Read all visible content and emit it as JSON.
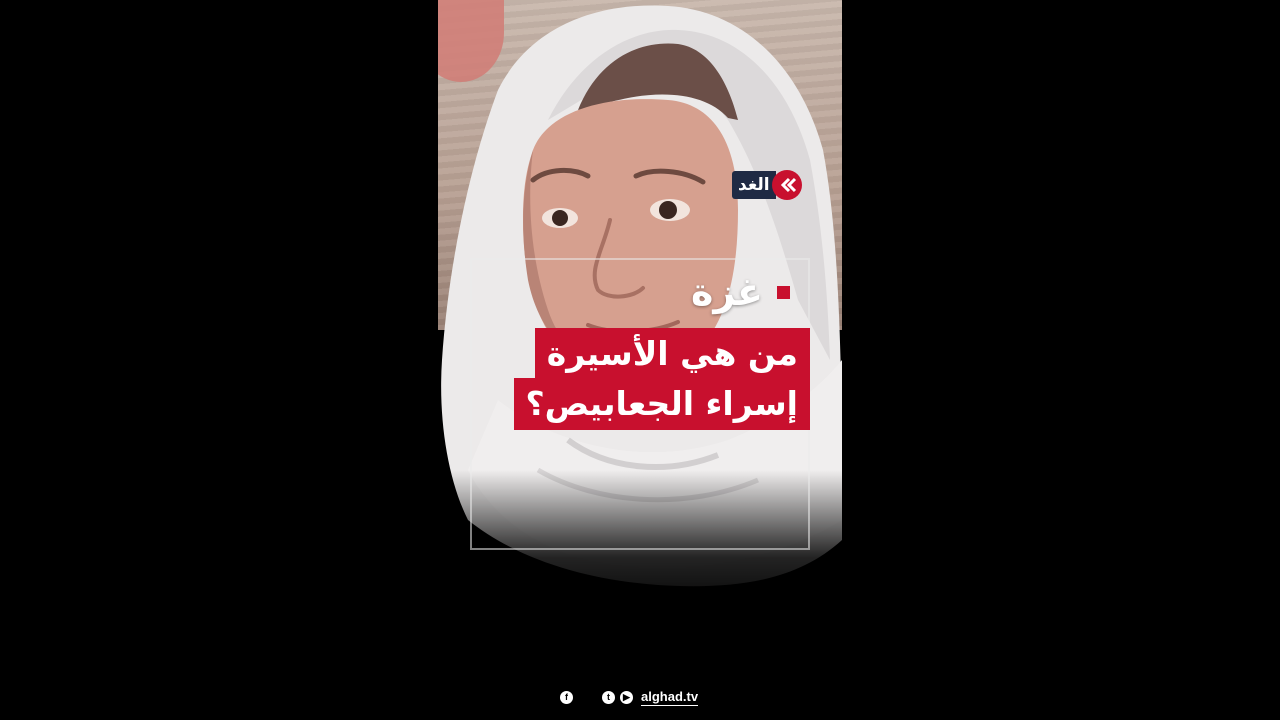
{
  "video": {
    "channel_logo_text": "الغد",
    "location_label": "غزة",
    "headline_line1": "من هي الأسيرة",
    "headline_line2": "إسراء الجعابيص؟"
  },
  "footer": {
    "site": "alghad.tv",
    "icons": [
      "facebook-icon",
      "twitter-icon",
      "youtube-icon"
    ]
  },
  "colors": {
    "accent": "#c8102e",
    "logo_bg": "#1f2a44",
    "background": "#000000"
  }
}
